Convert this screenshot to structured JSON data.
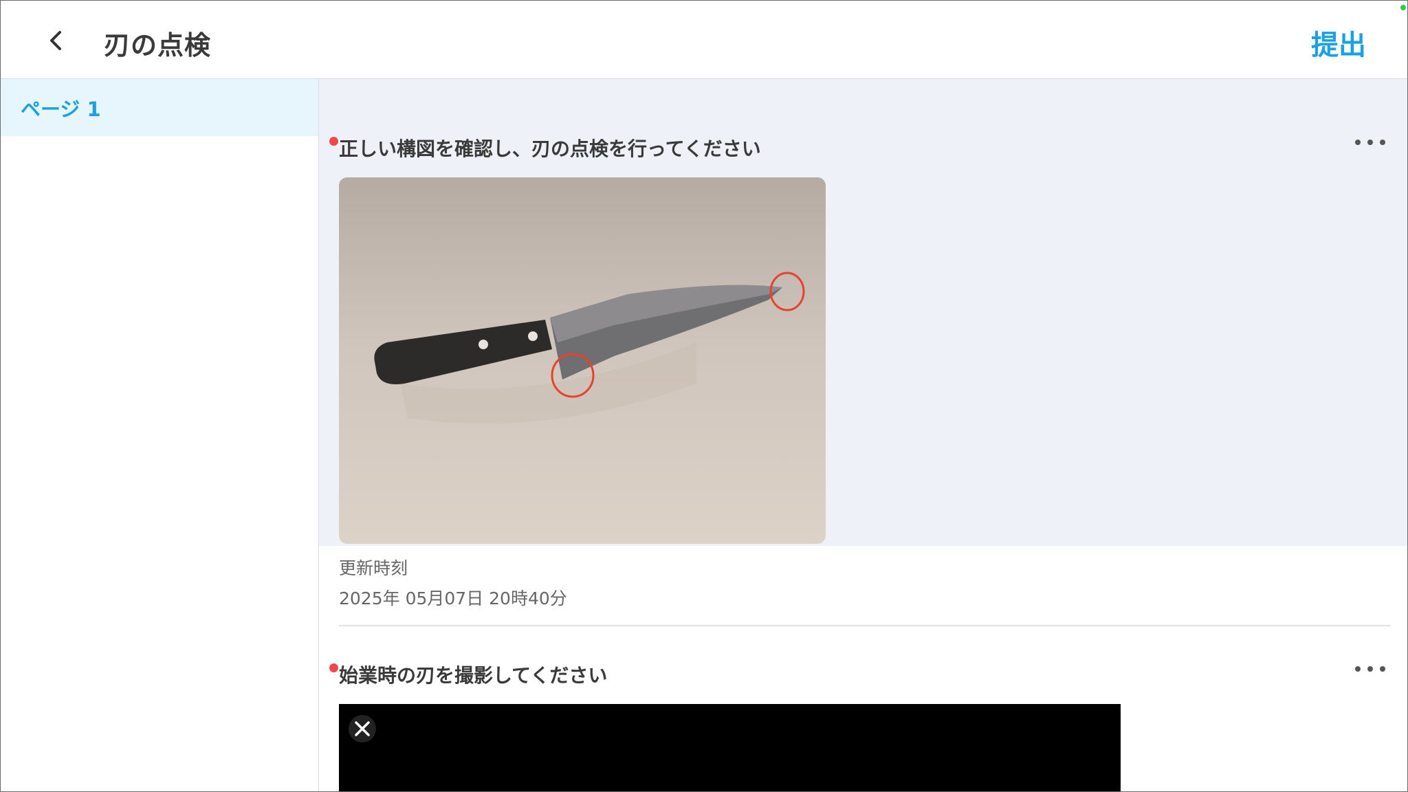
{
  "header": {
    "title": "刃の点検",
    "submit_label": "提出",
    "back_icon": "chevron-left-icon"
  },
  "sidebar": {
    "items": [
      {
        "label": "ページ 1",
        "selected": true
      }
    ]
  },
  "questions": [
    {
      "title": "正しい構図を確認し、刃の点検を行ってください",
      "required": true,
      "image_description": "knife-photo",
      "meta_label": "更新時刻",
      "meta_value": "2025年 05月07日 20時40分"
    },
    {
      "title": "始業時の刃を撮影してください",
      "required": true,
      "image_description": "camera-preview"
    }
  ],
  "colors": {
    "accent": "#1ba1e2",
    "required_dot": "#f0474b",
    "selected_bg": "#e7f6fd",
    "card_bg": "#eef1f8"
  }
}
